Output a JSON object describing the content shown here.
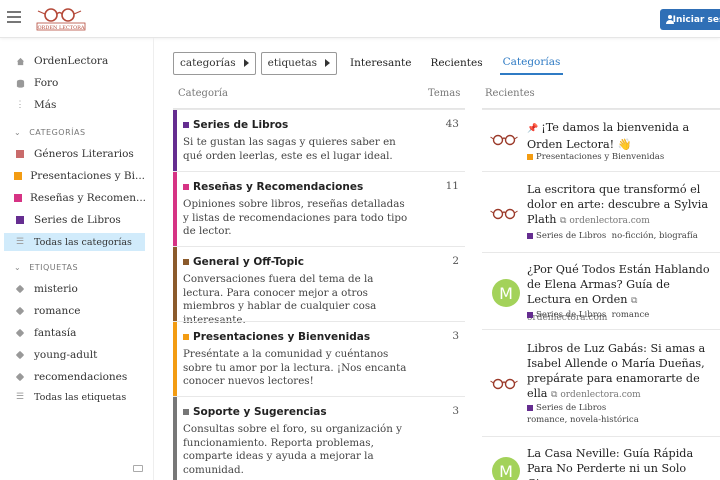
{
  "header": {
    "logo_text": "ORDEN LECTORA",
    "login_label": "Iniciar sesión"
  },
  "sidebar": {
    "top_items": [
      {
        "label": "OrdenLectora",
        "icon": "home-icon"
      },
      {
        "label": "Foro",
        "icon": "forum-icon"
      },
      {
        "label": "Más",
        "icon": "more-icon"
      }
    ],
    "categories_heading": "CATEGORÍAS",
    "categories": [
      {
        "label": "Géneros Literarios",
        "color": "#c96b6b"
      },
      {
        "label": "Presentaciones y Bi...",
        "color": "#f39c12"
      },
      {
        "label": "Reseñas y Recomen...",
        "color": "#d63384"
      },
      {
        "label": "Series de Libros",
        "color": "#652d90"
      }
    ],
    "all_categories": "Todas las categorías",
    "tags_heading": "ETIQUETAS",
    "tags": [
      "misterio",
      "romance",
      "fantasía",
      "young-adult",
      "recomendaciones"
    ],
    "all_tags": "Todas las etiquetas"
  },
  "nav": {
    "categories_dropdown": "categorías",
    "tags_dropdown": "etiquetas",
    "links": [
      "Interesante",
      "Recientes",
      "Categorías"
    ],
    "active": "Categorías"
  },
  "columns": {
    "category": "Categoría",
    "topics": "Temas",
    "recent": "Recientes"
  },
  "categories": [
    {
      "name": "Series de Libros",
      "color": "#652d90",
      "count": "43",
      "description": "Si te gustan las sagas y quieres saber en qué orden leerlas, este es el lugar ideal."
    },
    {
      "name": "Reseñas y Recomendaciones",
      "color": "#d63384",
      "count": "11",
      "description": "Opiniones sobre libros, reseñas detalladas y listas de recomendaciones para todo tipo de lector."
    },
    {
      "name": "General y Off-Topic",
      "color": "#8b5a2b",
      "count": "2",
      "description": "Conversaciones fuera del tema de la lectura. Para conocer mejor a otros miembros y hablar de cualquier cosa interesante."
    },
    {
      "name": "Presentaciones y Bienvenidas",
      "color": "#f39c12",
      "count": "3",
      "description": "Preséntate a la comunidad y cuéntanos sobre tu amor por la lectura. ¡Nos encanta conocer nuevos lectores!"
    },
    {
      "name": "Soporte y Sugerencias",
      "color": "#777777",
      "count": "3",
      "description": "Consultas sobre el foro, su organización y funcionamiento. Reporta problemas, comparte ideas y ayuda a mejorar la comunidad."
    }
  ],
  "recent": [
    {
      "title": "¡Te damos la bienvenida a Orden Lectora!",
      "emoji": "👋",
      "pinned": true,
      "host": "",
      "category": "Presentaciones y Bienvenidas",
      "category_color": "#f39c12",
      "tags": "",
      "avatar": ""
    },
    {
      "title": "La escritora que transformó el dolor en arte: descubre a Sylvia Plath",
      "host": "ordenlectora.com",
      "category": "Series de Libros",
      "category_color": "#652d90",
      "tags": "no-ficción, biografía",
      "avatar": ""
    },
    {
      "title": "¿Por Qué Todos Están Hablando de Elena Armas? Guía de Lectura en Orden",
      "host": "ordenlectora.com",
      "category": "Series de Libros",
      "category_color": "#652d90",
      "tags": "romance",
      "avatar": "M"
    },
    {
      "title": "Libros de Luz Gabás: Si amas a Isabel Allende o María Dueñas, prepárate para enamorarte de ella",
      "host": "ordenlectora.com",
      "category": "Series de Libros",
      "category_color": "#652d90",
      "tags": "romance, novela-histórica",
      "avatar": ""
    },
    {
      "title": "La Casa Neville: Guía Rápida Para No Perderte ni un Solo Giro",
      "host": "",
      "category": "",
      "category_color": "#652d90",
      "tags": "",
      "avatar": "M"
    }
  ]
}
